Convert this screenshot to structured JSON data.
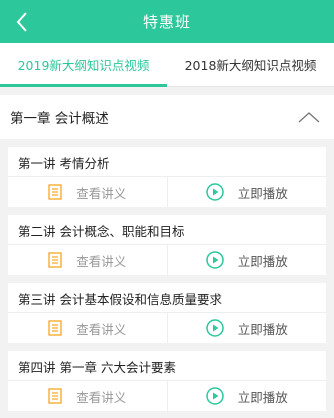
{
  "header": {
    "title": "特惠班",
    "back_icon": "chevron-left-icon"
  },
  "tabs": [
    {
      "label": "2019新大纲知识点视频",
      "active": true
    },
    {
      "label": "2018新大纲知识点视频",
      "active": false
    }
  ],
  "chapter": {
    "title": "第一章 会计概述",
    "toggle_icon": "chevron-up-icon"
  },
  "lessons": [
    {
      "title": "第一讲 考情分析",
      "handout_label": "查看讲义",
      "play_label": "立即播放"
    },
    {
      "title": "第二讲 会计概念、职能和目标",
      "handout_label": "查看讲义",
      "play_label": "立即播放"
    },
    {
      "title": "第三讲 会计基本假设和信息质量要求",
      "handout_label": "查看讲义",
      "play_label": "立即播放"
    },
    {
      "title": "第四讲 第一章 六大会计要素",
      "handout_label": "查看讲义",
      "play_label": "立即播放"
    }
  ],
  "colors": {
    "accent": "#2cc79a",
    "handout_icon": "#f5a623"
  }
}
